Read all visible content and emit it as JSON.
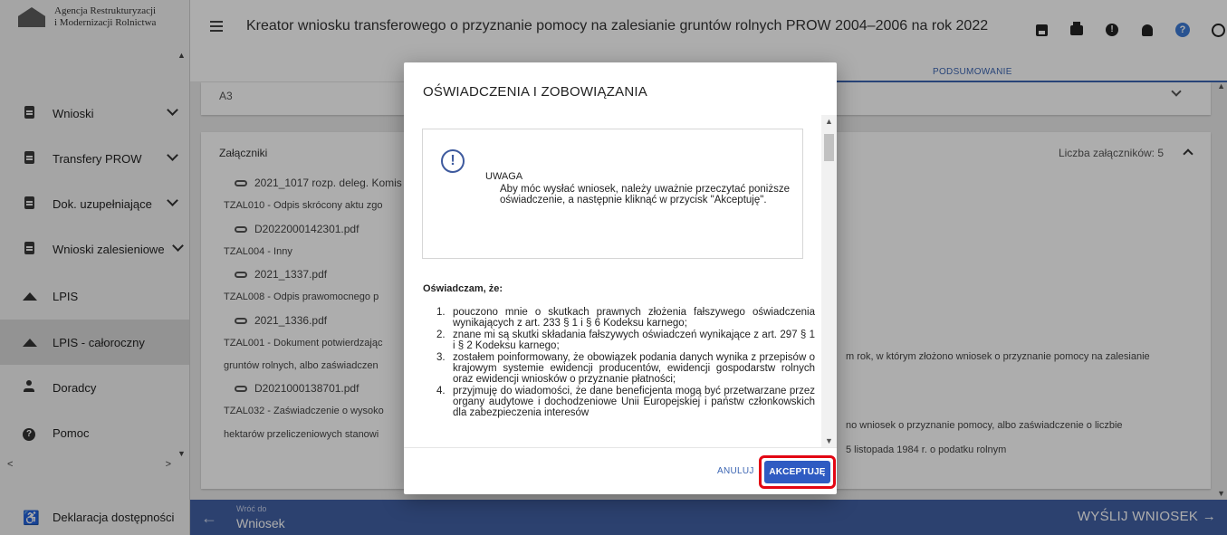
{
  "brand": {
    "line1": "Agencja Restrukturyzacji",
    "line2": "i Modernizacji Rolnictwa"
  },
  "sidebar": {
    "items": [
      {
        "label": "Wnioski",
        "icon": "document-icon",
        "chevron": true
      },
      {
        "label": "Transfery PROW",
        "icon": "document-icon",
        "chevron": true
      },
      {
        "label": "Dok. uzupełniające",
        "icon": "document-icon",
        "chevron": true
      },
      {
        "label": "Wnioski zalesieniowe",
        "icon": "document-icon",
        "chevron": true
      },
      {
        "label": "LPIS",
        "icon": "landscape-icon",
        "chevron": false
      },
      {
        "label": "LPIS - całoroczny",
        "icon": "landscape-icon",
        "chevron": false,
        "active": true
      },
      {
        "label": "Doradcy",
        "icon": "person-icon",
        "chevron": false
      },
      {
        "label": "Pomoc",
        "icon": "help-icon",
        "chevron": false
      }
    ],
    "accessibility": "Deklaracja dostępności"
  },
  "header": {
    "title": "Kreator wniosku transferowego o przyznanie pomocy na zalesianie gruntów rolnych PROW 2004–2006 na rok 2022",
    "icons": [
      "save-icon",
      "print-icon",
      "alert-icon",
      "bell-icon",
      "help-icon",
      "account-icon"
    ],
    "alert_glyph": "!",
    "help_glyph": "?",
    "tab": "PODSUMOWANIE"
  },
  "content": {
    "top_card_peek": "A3",
    "attachments": {
      "title": "Załączniki",
      "count": "Liczba załączników: 5",
      "rows": [
        {
          "file": "2021_1017 rozp. deleg. Komis",
          "desc": "TZAL010 - Odpis skrócony aktu zgo"
        },
        {
          "file": "D2022000142301.pdf",
          "desc": "TZAL004 - Inny"
        },
        {
          "file": "2021_1337.pdf",
          "desc": "TZAL008 - Odpis prawomocnego p"
        },
        {
          "file": "2021_1336.pdf",
          "desc": "TZAL001 - Dokument potwierdzając"
        },
        {
          "file": "D2021000138701.pdf",
          "desc": "TZAL032 - Zaświadczenie o wysoko"
        }
      ],
      "extra_left_1": "gruntów rolnych, albo zaświadczen",
      "extra_left_2": "hektarów przeliczeniowych stanowi",
      "right_1": "m rok, w którym złożono wniosek o przyznanie pomocy na zalesianie",
      "right_2": "no wniosek o przyznanie pomocy, albo zaświadczenie o liczbie",
      "right_3": "5 listopada 1984 r. o podatku rolnym"
    }
  },
  "footer": {
    "back_small": "Wróć do",
    "back_big": "Wniosek",
    "send": "WYŚLIJ WNIOSEK"
  },
  "dialog": {
    "title": "OŚWIADCZENIA I ZOBOWIĄZANIA",
    "warn_icon": "!",
    "warn_head": "UWAGA",
    "warn_text": "Aby móc wysłać wniosek, należy uważnie przeczytać poniższe oświadczenie, a następnie kliknąć w przycisk \"Akceptuję\".",
    "declare_head": "Oświadczam, że:",
    "items": [
      {
        "num": "1.",
        "text": "pouczono mnie o skutkach prawnych złożenia fałszywego oświadczenia wynikających z art. 233 § 1 i § 6 Kodeksu karnego;"
      },
      {
        "num": "2.",
        "text": "znane mi są skutki składania fałszywych oświadczeń wynikające z art. 297 § 1 i § 2 Kodeksu karnego;"
      },
      {
        "num": "3.",
        "text": "zostałem poinformowany, że obowiązek podania danych wynika z przepisów o krajowym systemie ewidencji producentów, ewidencji gospodarstw rolnych oraz ewidencji wniosków o przyznanie płatności;"
      },
      {
        "num": "4.",
        "text": "przyjmuję do wiadomości, że dane beneficjenta mogą być przetwarzane przez organy audytowe i dochodzeniowe Unii Europejskiej i państw członkowskich dla zabezpieczenia interesów"
      }
    ],
    "cancel": "ANULUJ",
    "accept": "AKCEPTUJĘ"
  },
  "colors": {
    "primary": "#4260a4",
    "accept_button": "#2f5bc2",
    "highlight_ring": "#e30613",
    "tab_accent": "#3d66b3"
  }
}
